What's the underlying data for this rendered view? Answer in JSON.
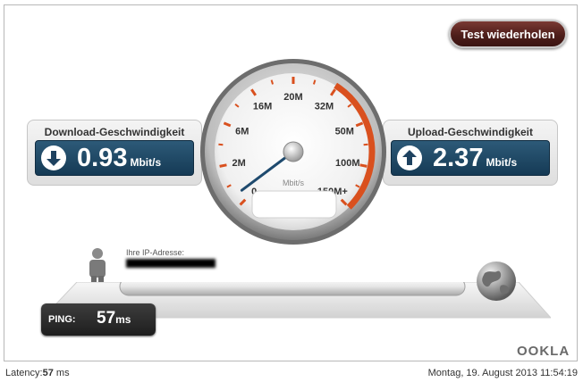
{
  "retest_button": {
    "label": "Test wiederholen"
  },
  "download": {
    "title": "Download-Geschwindigkeit",
    "value": "0.93",
    "unit": "Mbit/s"
  },
  "upload": {
    "title": "Upload-Geschwindigkeit",
    "value": "2.37",
    "unit": "Mbit/s"
  },
  "gauge": {
    "ticks": [
      "0",
      "2M",
      "6M",
      "16M",
      "20M",
      "32M",
      "50M",
      "100M",
      "150M+"
    ],
    "unit": "Mbit/s",
    "needle_fraction": 0.03
  },
  "ip": {
    "label": "Ihre IP-Adresse:",
    "value": ""
  },
  "ping": {
    "label": "PING:",
    "value": "57",
    "unit": "ms"
  },
  "brand": "OOKLA",
  "footer": {
    "latency_label": "Latency:",
    "latency_value": "57",
    "latency_unit": "ms",
    "timestamp": "Montag, 19. August 2013 11:54:19"
  },
  "colors": {
    "retest_bg": "#4e1e1a",
    "value_box": "#1f4765",
    "gauge_red": "#d9501e"
  }
}
